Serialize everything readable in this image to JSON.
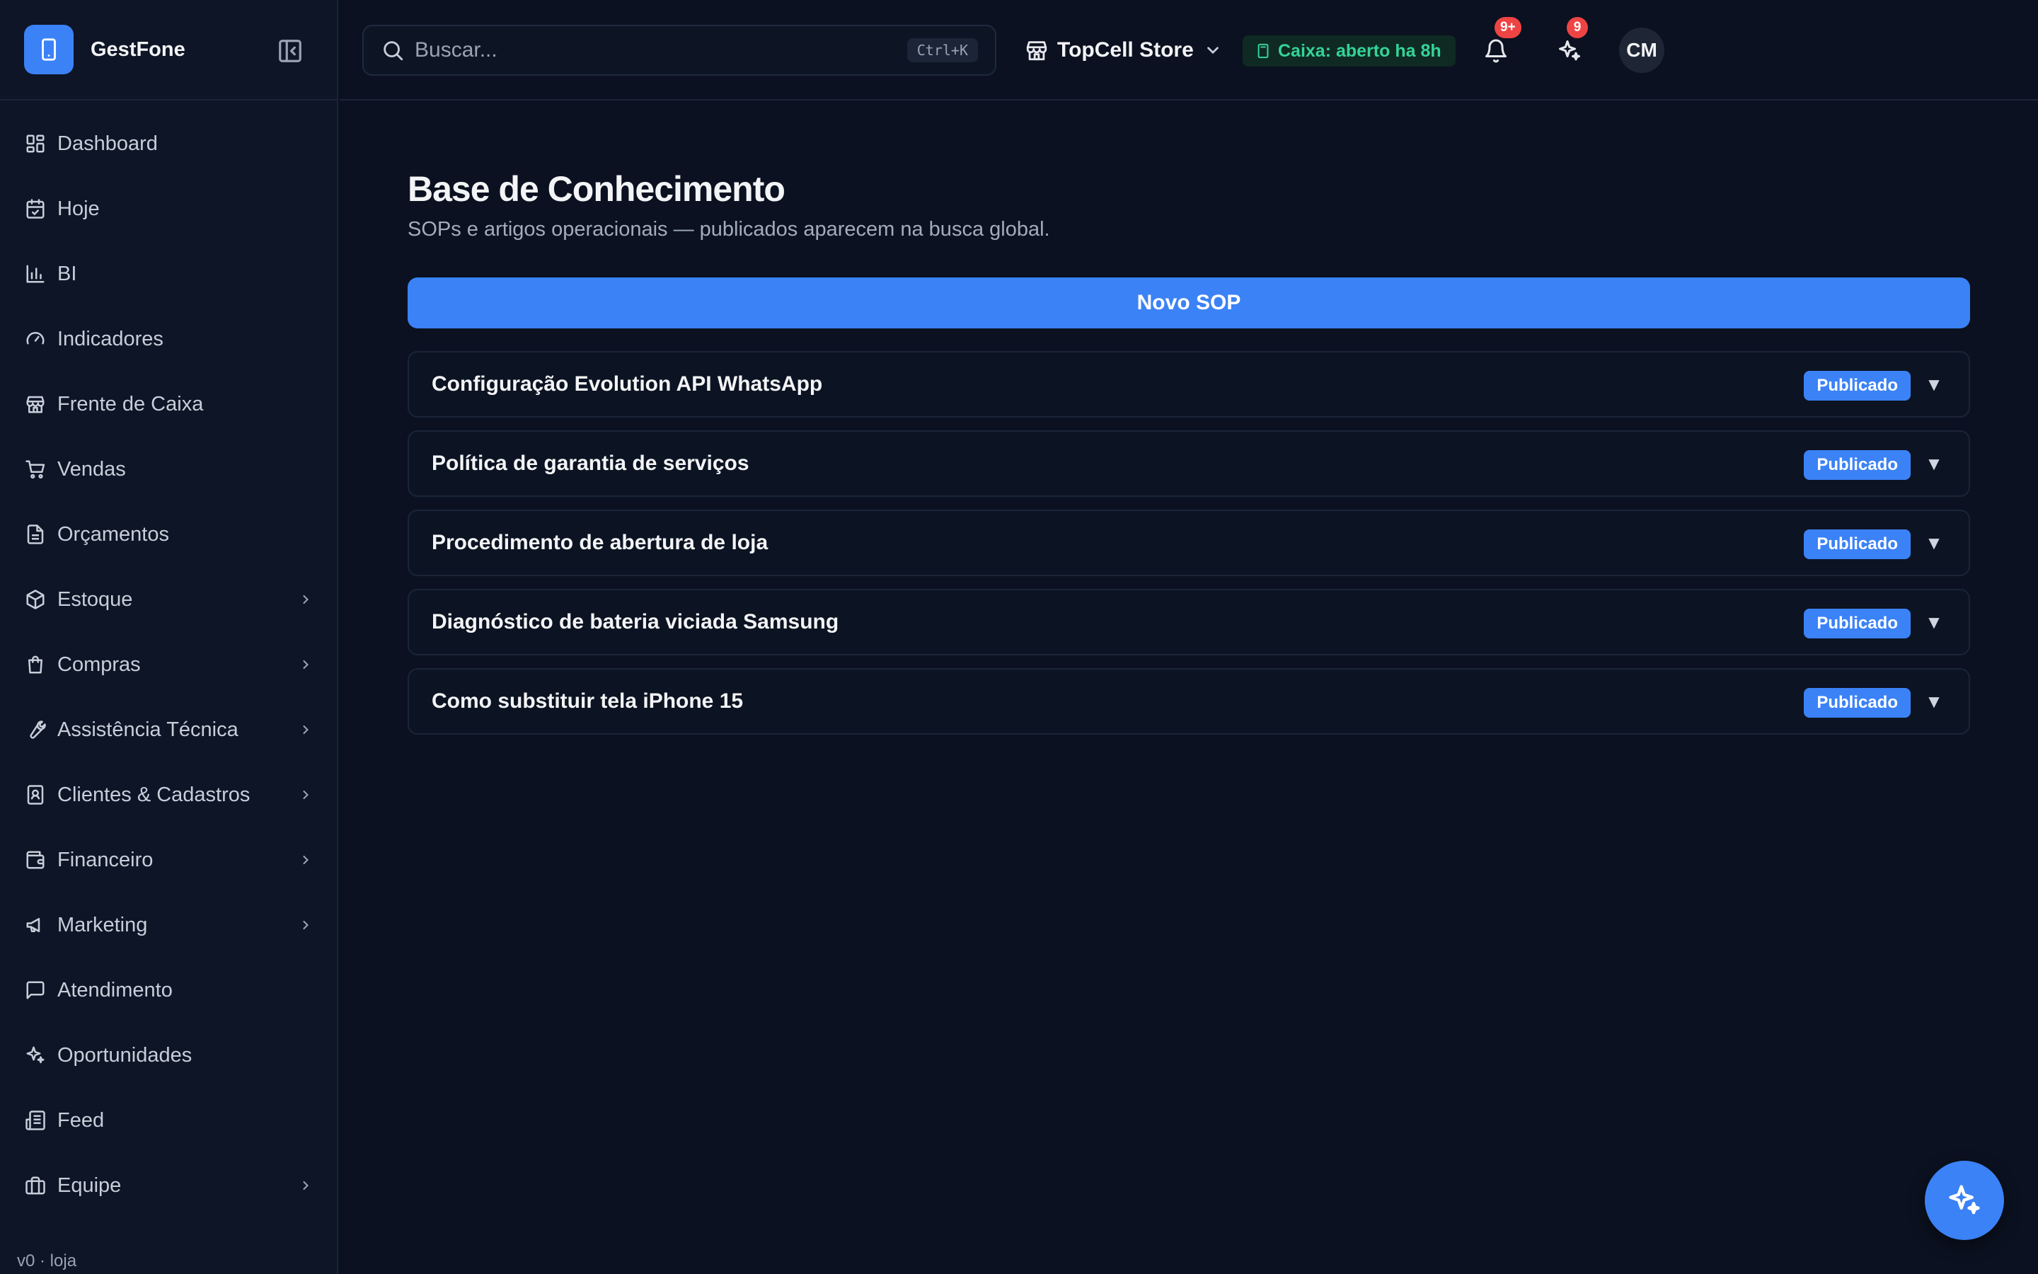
{
  "brand": {
    "name": "GestFone",
    "icon": "smartphone-icon"
  },
  "sidebar": {
    "items": [
      {
        "label": "Dashboard",
        "icon": "layout-grid-icon",
        "has_submenu": false
      },
      {
        "label": "Hoje",
        "icon": "calendar-check-icon",
        "has_submenu": false
      },
      {
        "label": "BI",
        "icon": "bar-chart-icon",
        "has_submenu": false
      },
      {
        "label": "Indicadores",
        "icon": "gauge-icon",
        "has_submenu": false
      },
      {
        "label": "Frente de Caixa",
        "icon": "store-icon",
        "has_submenu": false
      },
      {
        "label": "Vendas",
        "icon": "shopping-cart-icon",
        "has_submenu": false
      },
      {
        "label": "Orçamentos",
        "icon": "file-text-icon",
        "has_submenu": false
      },
      {
        "label": "Estoque",
        "icon": "package-icon",
        "has_submenu": true
      },
      {
        "label": "Compras",
        "icon": "shopping-bag-icon",
        "has_submenu": true
      },
      {
        "label": "Assistência Técnica",
        "icon": "wrench-icon",
        "has_submenu": true
      },
      {
        "label": "Clientes & Cadastros",
        "icon": "contact-icon",
        "has_submenu": true
      },
      {
        "label": "Financeiro",
        "icon": "wallet-icon",
        "has_submenu": true
      },
      {
        "label": "Marketing",
        "icon": "megaphone-icon",
        "has_submenu": true
      },
      {
        "label": "Atendimento",
        "icon": "message-square-icon",
        "has_submenu": false
      },
      {
        "label": "Oportunidades",
        "icon": "sparkles-icon",
        "has_submenu": false
      },
      {
        "label": "Feed",
        "icon": "newspaper-icon",
        "has_submenu": false
      },
      {
        "label": "Equipe",
        "icon": "briefcase-icon",
        "has_submenu": true
      }
    ],
    "version": "v0 · loja"
  },
  "header": {
    "search_placeholder": "Buscar...",
    "search_shortcut": "Ctrl+K",
    "store_name": "TopCell Store",
    "caixa_status": "Caixa: aberto ha 8h",
    "notifications_badge": "9+",
    "ai_badge": "9",
    "user_initials": "CM"
  },
  "main": {
    "title": "Base de Conhecimento",
    "subtitle": "SOPs e artigos operacionais — publicados aparecem na busca global.",
    "new_button": "Novo SOP",
    "sops": [
      {
        "title": "Configuração Evolution API WhatsApp",
        "status": "Publicado"
      },
      {
        "title": "Política de garantia de serviços",
        "status": "Publicado"
      },
      {
        "title": "Procedimento de abertura de loja",
        "status": "Publicado"
      },
      {
        "title": "Diagnóstico de bateria viciada Samsung",
        "status": "Publicado"
      },
      {
        "title": "Como substituir tela iPhone 15",
        "status": "Publicado"
      }
    ],
    "toggle_glyph": "▼"
  },
  "colors": {
    "accent": "#3b82f6",
    "background": "#0b1120",
    "sidebar": "#0d1526",
    "success": "#34d399",
    "danger": "#ef4444"
  }
}
